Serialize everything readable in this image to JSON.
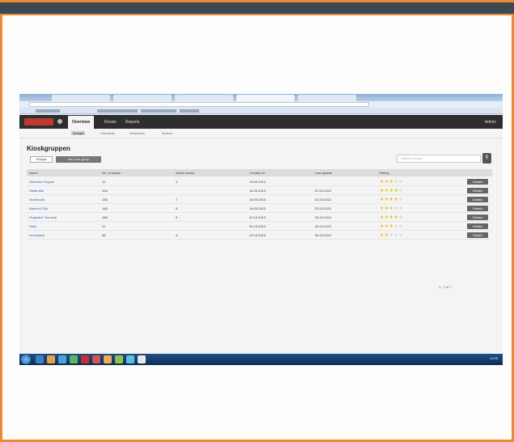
{
  "app": {
    "nav_tabs": [
      "Overview",
      "Kiosks",
      "Reports"
    ],
    "user_label": "Admin",
    "subnav": [
      "Groups",
      "Checklists",
      "Schedules",
      "Archive"
    ],
    "page_title": "Kioskgruppen",
    "btn_primary": "Groups",
    "btn_secondary": "Add new group",
    "search_placeholder": "Search Groups",
    "search_icon": "magnifier-icon"
  },
  "table": {
    "headers": [
      "Name",
      "No. of kiosks",
      "Active kiosks",
      "Created at",
      "Last update",
      "Rating",
      ""
    ],
    "rows": [
      {
        "name": "Oberland Gruppe",
        "kiosks": "12",
        "active": "3",
        "created": "10.09.2013",
        "updated": "",
        "rating": 3,
        "action": "Details"
      },
      {
        "name": "Stadtmitte",
        "kiosks": "104",
        "active": "",
        "created": "14.09.2013",
        "updated": "21.10.2013",
        "rating": 4,
        "action": "Details"
      },
      {
        "name": "Nordbezirk",
        "kiosks": "136",
        "active": "7",
        "created": "18.09.2013",
        "updated": "22.10.2013",
        "rating": 4,
        "action": "Details"
      },
      {
        "name": "Bahnhof Süd",
        "kiosks": "148",
        "active": "5",
        "created": "19.09.2013",
        "updated": "23.10.2013",
        "rating": 3,
        "action": "Details"
      },
      {
        "name": "Flughafen Terminal",
        "kiosks": "186",
        "active": "9",
        "created": "02.10.2013",
        "updated": "24.10.2013",
        "rating": 4,
        "action": "Details"
      },
      {
        "name": "West",
        "kiosks": "21",
        "active": "",
        "created": "05.10.2013",
        "updated": "25.10.2013",
        "rating": 3,
        "action": "Details"
      },
      {
        "name": "Innenstadt",
        "kiosks": "83",
        "active": "4",
        "created": "12.10.2013",
        "updated": "26.10.2013",
        "rating": 2,
        "action": "Details"
      }
    ],
    "max_rating": 5
  },
  "pager_text": "1 - 7 of 7",
  "taskbar_clock": "10:35",
  "colors": {
    "frame": "#f08a2c",
    "topbar": "#3a4a55",
    "appbar": "#2e2e2e",
    "star_on": "#f2c200",
    "link": "#2a5db0"
  }
}
